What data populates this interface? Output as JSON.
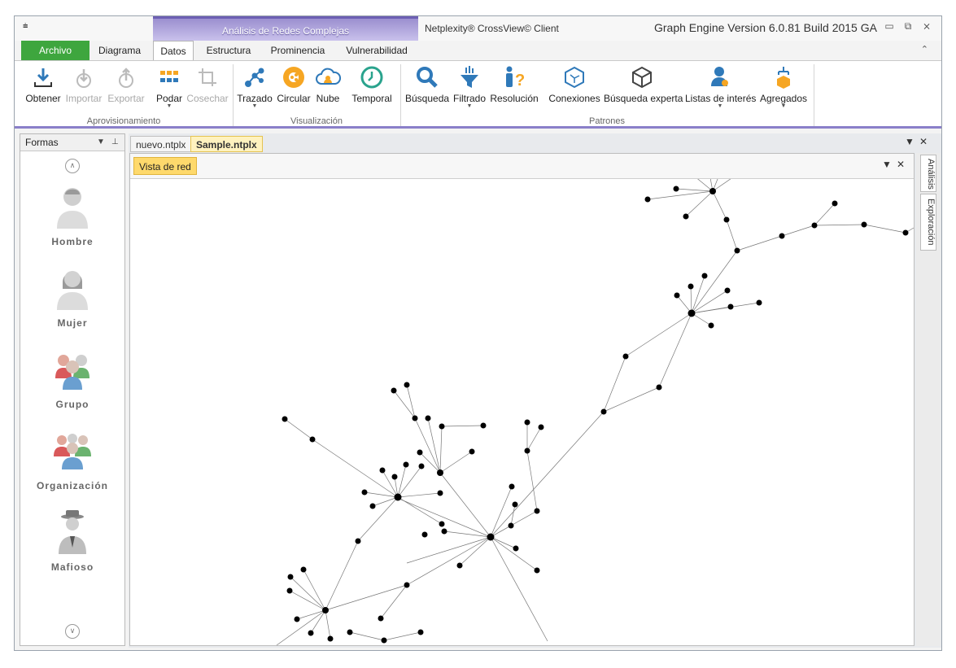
{
  "window": {
    "qat_symbol": "⩧",
    "context_group": "Análisis de Redes Complejas",
    "app_title": "Netplexity® CrossView© Client",
    "engine_title": "Graph Engine Version 6.0.81 Build 2015 GA",
    "controls": [
      "▭",
      "⧉",
      "⨯"
    ]
  },
  "tabs": [
    "Archivo",
    "Diagrama",
    "Datos",
    "Estructura",
    "Prominencia",
    "Vulnerabilidad"
  ],
  "active_tab": "Datos",
  "ribbon": {
    "groups": [
      {
        "label": "Aprovisionamiento",
        "buttons": [
          "Obtener",
          "Importar",
          "Exportar",
          "Podar",
          "Cosechar"
        ]
      },
      {
        "label": "Visualización",
        "buttons": [
          "Trazado",
          "Circular",
          "Nube",
          "Temporal"
        ]
      },
      {
        "label": "Patrones",
        "buttons": [
          "Búsqueda",
          "Filtrado",
          "Resolución",
          "Conexiones",
          "Búsqueda experta",
          "Listas de interés",
          "Agregados"
        ]
      }
    ]
  },
  "left_panel": {
    "title": "Formas",
    "shapes": [
      "Hombre",
      "Mujer",
      "Grupo",
      "Organización",
      "Mafioso"
    ]
  },
  "documents": {
    "tabs": [
      "nuevo.ntplx",
      "Sample.ntplx"
    ],
    "active": "Sample.ntplx",
    "view_button": "Vista de red",
    "side_tabs": [
      "Análisis",
      "Exploración"
    ]
  },
  "colors": {
    "archivo_green": "#3ea63e",
    "context_purple": "#8a7fc9",
    "active_doc_tab": "#fff2bf",
    "view_button": "#fed96c",
    "icon_blue": "#2f79b9",
    "icon_orange": "#f6a623",
    "icon_teal": "#2aa38d"
  }
}
